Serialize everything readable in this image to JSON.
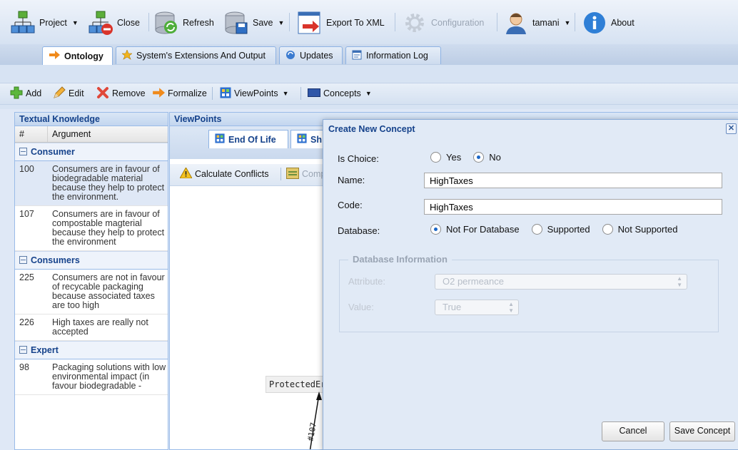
{
  "toolbar": {
    "project": "Project",
    "close": "Close",
    "refresh": "Refresh",
    "save": "Save",
    "export": "Export To XML",
    "configuration": "Configuration",
    "user": "tamani",
    "about": "About"
  },
  "tabs": {
    "ontology": "Ontology",
    "extensions": "System's Extensions And Output",
    "updates": "Updates",
    "info_log": "Information Log"
  },
  "actions": {
    "add": "Add",
    "edit": "Edit",
    "remove": "Remove",
    "formalize": "Formalize",
    "viewpoints": "ViewPoints",
    "concepts": "Concepts"
  },
  "left_panel": {
    "title": "Textual Knowledge",
    "col_num": "#",
    "col_arg": "Argument",
    "groups": [
      {
        "name": "Consumer",
        "rows": [
          {
            "num": "100",
            "arg": "Consumers are in favour of biodegradable material because they help to protect the environment."
          },
          {
            "num": "107",
            "arg": "Consumers are in favour of compostable magterial because they help to protect the environment"
          }
        ]
      },
      {
        "name": "Consumers",
        "rows": [
          {
            "num": "225",
            "arg": "Consumers are not in favour of recycable packaging because associated taxes are too high"
          },
          {
            "num": "226",
            "arg": "High taxes are really not accepted"
          }
        ]
      },
      {
        "name": "Expert",
        "rows": [
          {
            "num": "98",
            "arg": "Packaging solutions with low environmental impact (in favour biodegradable -"
          }
        ]
      }
    ]
  },
  "center_panel": {
    "title": "ViewPoints",
    "tab1": "End Of Life",
    "tab2": "Sh",
    "calc_conflicts": "Calculate Conflicts",
    "comp": "Comp",
    "node_label": "ProtectedEr",
    "edge_label": "#107"
  },
  "dialog": {
    "title": "Create New Concept",
    "is_choice_label": "Is Choice:",
    "yes": "Yes",
    "no": "No",
    "is_choice_value": "No",
    "name_label": "Name:",
    "name_value": "HighTaxes",
    "code_label": "Code:",
    "code_value": "HighTaxes",
    "database_label": "Database:",
    "db_opt1": "Not For Database",
    "db_opt2": "Supported",
    "db_opt3": "Not Supported",
    "database_value": "Not For Database",
    "db_info_title": "Database Information",
    "attribute_label": "Attribute:",
    "attribute_value": "O2 permeance",
    "value_label": "Value:",
    "value_value": "True",
    "cancel": "Cancel",
    "save_concept": "Save Concept"
  }
}
